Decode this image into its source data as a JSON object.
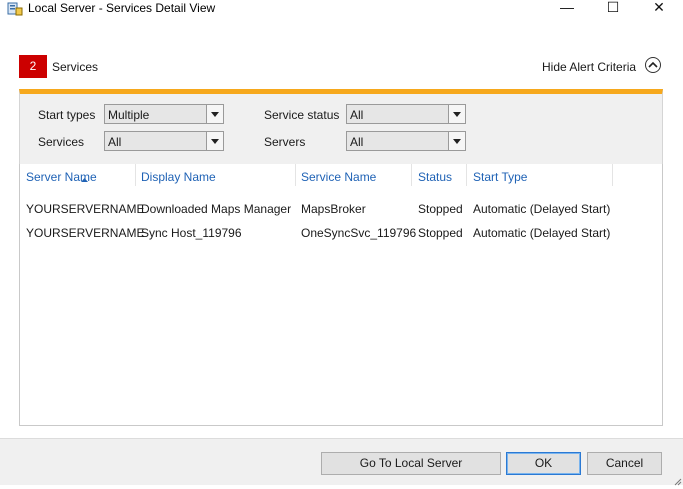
{
  "window": {
    "title": "Local Server - Services Detail View",
    "min_glyph": "—",
    "max_glyph": "☐",
    "close_glyph": "✕"
  },
  "alert": {
    "count": "2",
    "label": "Services",
    "toggle_label": "Hide Alert Criteria",
    "badge_color": "#cc0000",
    "accent_color": "#f6a81c"
  },
  "filters": {
    "start_types": {
      "label": "Start types",
      "value": "Multiple"
    },
    "services": {
      "label": "Services",
      "value": "All"
    },
    "service_status": {
      "label": "Service status",
      "value": "All"
    },
    "servers": {
      "label": "Servers",
      "value": "All"
    }
  },
  "table": {
    "columns": [
      "Server Name",
      "Display Name",
      "Service Name",
      "Status",
      "Start Type"
    ],
    "sorted_column": "Server Name",
    "rows": [
      [
        "YOURSERVERNAME",
        "Downloaded Maps Manager",
        "MapsBroker",
        "Stopped",
        "Automatic (Delayed Start)"
      ],
      [
        "YOURSERVERNAME",
        "Sync Host_119796",
        "OneSyncSvc_119796",
        "Stopped",
        "Automatic (Delayed Start)"
      ]
    ]
  },
  "footer": {
    "go_to_label": "Go To Local Server",
    "ok_label": "OK",
    "cancel_label": "Cancel"
  }
}
